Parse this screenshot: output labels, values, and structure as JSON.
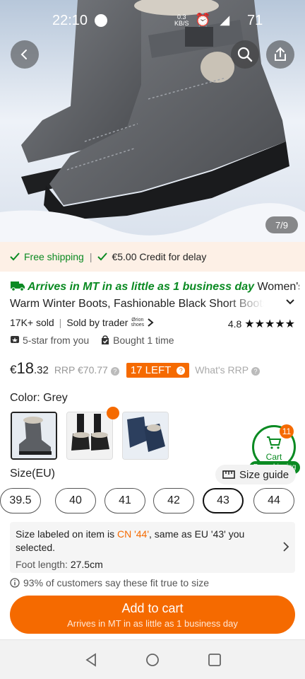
{
  "status_bar": {
    "time": "22:10",
    "net_speed": "0.3",
    "net_unit": "KB/S",
    "battery": "71"
  },
  "hero": {
    "image_counter": "7/9",
    "back_icon": "chevron-left-icon",
    "search_icon": "search-icon",
    "share_icon": "share-icon"
  },
  "shipping": {
    "free_shipping": "Free shipping",
    "credit": "€5.00 Credit for delay"
  },
  "product": {
    "arrives": "Arrives in MT in as little as 1 business day",
    "title_part1": "Women's",
    "title_part2": "Warm Winter Boots, Fashionable Black Short Boots",
    "sold": "17K+ sold",
    "sold_by": "Sold by trader",
    "trader_logo_top": "Ørion",
    "trader_logo_bottom": "shoes",
    "rating": "4.8",
    "stars": "★★★★★",
    "badge_review": "5-star from you",
    "badge_bought": "Bought 1 time"
  },
  "price": {
    "currency": "€",
    "integer": "18",
    "decimal": ".32",
    "rrp": "RRP €70.77",
    "left": "17 LEFT",
    "whats_rrp": "What's RRP"
  },
  "color": {
    "label": "Color: Grey",
    "options": [
      "Grey",
      "Black",
      "Navy"
    ],
    "selected": "Grey"
  },
  "cart": {
    "count": "11",
    "label": "Cart",
    "free_shipping": "Free shipping"
  },
  "size": {
    "label": "Size(EU)",
    "guide": "Size guide",
    "options": [
      "39.5",
      "40",
      "41",
      "42",
      "43",
      "44"
    ],
    "selected": "43",
    "info_prefix": "Size labeled on item is ",
    "info_cn": "CN '44'",
    "info_suffix": ", same as EU '43' you selected.",
    "foot_label": "Foot length:",
    "foot_value": "27.5cm",
    "fit": "93% of customers say these fit true to size"
  },
  "add_to_cart": {
    "label": "Add to cart",
    "sub": "Arrives in MT in as little as 1 business day"
  },
  "colors": {
    "accent": "#f56a00",
    "green": "#0a8a22"
  }
}
